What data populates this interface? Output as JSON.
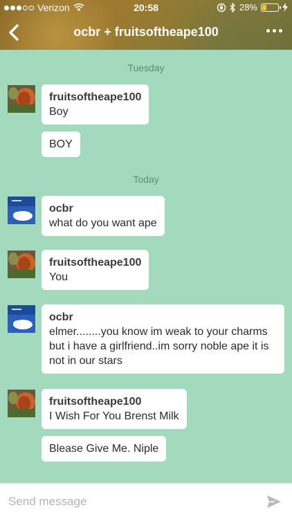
{
  "status_bar": {
    "carrier": "Verizon",
    "time": "20:58",
    "battery": "28%",
    "battery_level": 0.28
  },
  "nav": {
    "title": "ocbr + fruitsoftheape100",
    "back_icon": "chevron-left-icon",
    "more_icon": "more-dots-icon"
  },
  "conversation": {
    "days": [
      "Tuesday",
      "Today"
    ],
    "messages": [
      {
        "user": "fruitsoftheape100",
        "text": "Boy"
      },
      {
        "text": "BOY"
      },
      {
        "user": "ocbr",
        "text": "what do you want ape"
      },
      {
        "user": "fruitsoftheape100",
        "text": "You"
      },
      {
        "user": "ocbr",
        "text": "elmer........you know im weak to your charms but i have a girlfriend..im sorry noble ape it is not in our stars"
      },
      {
        "user": "fruitsoftheape100",
        "text": "I Wish For You Brenst Milk"
      },
      {
        "text": "Blease Give Me. Niple"
      }
    ]
  },
  "input": {
    "placeholder": "Send message",
    "send_icon": "send-icon"
  }
}
